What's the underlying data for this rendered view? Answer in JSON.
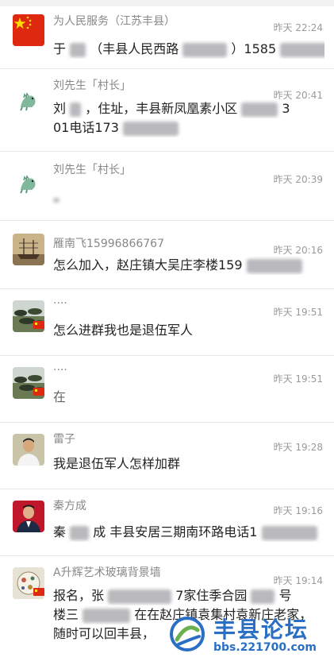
{
  "chats": [
    {
      "name": "为人民服务（江苏丰县）",
      "time": "昨天 22:24",
      "msg_a": "于",
      "msg_b": "（丰县人民西路",
      "msg_c": "）1585",
      "avatar": "china-flag-icon"
    },
    {
      "name": "刘先生「村长」",
      "time": "昨天 20:41",
      "line1_a": "刘",
      "line1_b": "，住址，丰县新凤凰素小区",
      "line1_c": "3",
      "line2": "01电话173",
      "avatar": "dinosaur-icon"
    },
    {
      "name": "刘先生「村长」",
      "time": "昨天 20:39",
      "msg": "",
      "avatar": "dinosaur-icon"
    },
    {
      "name": "雁南飞15996866767",
      "time": "昨天 20:16",
      "msg_a": "怎么加入，赵庄镇大吴庄李楼159",
      "avatar": "sailing-ship-photo"
    },
    {
      "name": "····",
      "time": "昨天 19:51",
      "msg": "怎么进群我也是退伍军人",
      "avatar": "tanks-photo"
    },
    {
      "name": "····",
      "time": "昨天 19:51",
      "msg": "在",
      "avatar": "tanks-photo"
    },
    {
      "name": "雷子",
      "time": "昨天 19:28",
      "msg": "我是退伍军人怎样加群",
      "avatar": "man-photo"
    },
    {
      "name": "秦方成",
      "time": "昨天 19:16",
      "msg_a": "秦",
      "msg_b": "成 丰县安居三期南环路电话1",
      "avatar": "officer-photo"
    },
    {
      "name": "A升辉艺术玻璃背景墙",
      "time": "昨天 19:14",
      "line1_a": "报名，张",
      "line1_b": "7家住季合园",
      "line1_c": "号",
      "line2_a": "楼三",
      "line2_b": "在在赵庄镇袁集村袁新庄老家，",
      "line3": "随时可以回丰县，",
      "avatar": "glass-art-photo"
    }
  ],
  "watermark": {
    "title": "丰县论坛",
    "url": "bbs.221700.com"
  },
  "colors": {
    "name_gray": "#888888",
    "time_gray": "#9a9a9a",
    "divider": "#e9e9e9",
    "flag_red": "#de2910",
    "flag_yellow": "#ffde00",
    "watermark_blue": "#2a6fc4"
  }
}
